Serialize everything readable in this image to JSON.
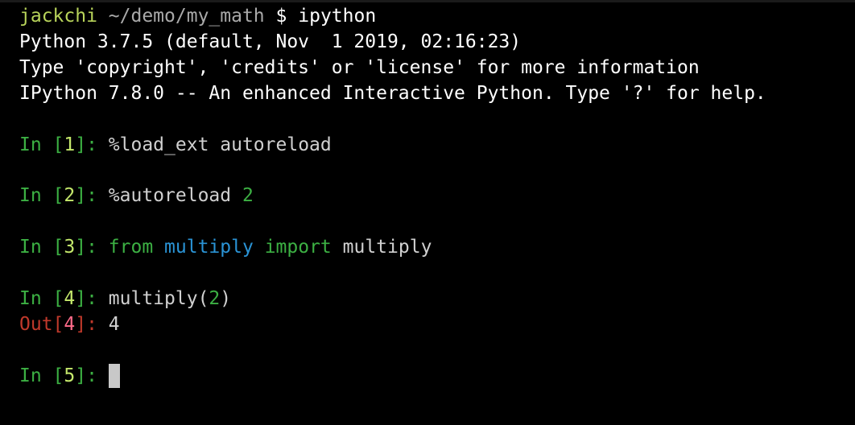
{
  "colors": {
    "background": "#000000",
    "prompt_green": "#3cb043",
    "prompt_number": "#c5e86c",
    "keyword_green": "#3cb043",
    "module_blue": "#2a93d5",
    "out_red": "#c0392b",
    "out_number": "#ff6b8a",
    "user": "#b8d45a",
    "cursor": "#c8c8c8"
  },
  "shell": {
    "user": "jackchi",
    "path": "~/demo/my_math",
    "symbol": "$",
    "command": "ipython"
  },
  "banner": {
    "line1": "Python 3.7.5 (default, Nov  1 2019, 02:16:23)",
    "line2": "Type 'copyright', 'credits' or 'license' for more information",
    "line3": "IPython 7.8.0 -- An enhanced Interactive Python. Type '?' for help."
  },
  "cells": [
    {
      "in_label": "In [",
      "number": "1",
      "close": "]: ",
      "code": "%load_ext autoreload"
    },
    {
      "in_label": "In [",
      "number": "2",
      "close": "]: ",
      "code": "%autoreload ",
      "arg": "2"
    },
    {
      "in_label": "In [",
      "number": "3",
      "close": "]: ",
      "kw_from": "from",
      "module": "multiply",
      "kw_import": "import",
      "name": "multiply"
    },
    {
      "in_label": "In [",
      "number": "4",
      "close": "]: ",
      "code": "multiply(",
      "arg": "2",
      "code_end": ")",
      "out_label": "Out[",
      "out_number": "4",
      "out_close": "]: ",
      "out_value": "4"
    },
    {
      "in_label": "In [",
      "number": "5",
      "close": "]: "
    }
  ]
}
